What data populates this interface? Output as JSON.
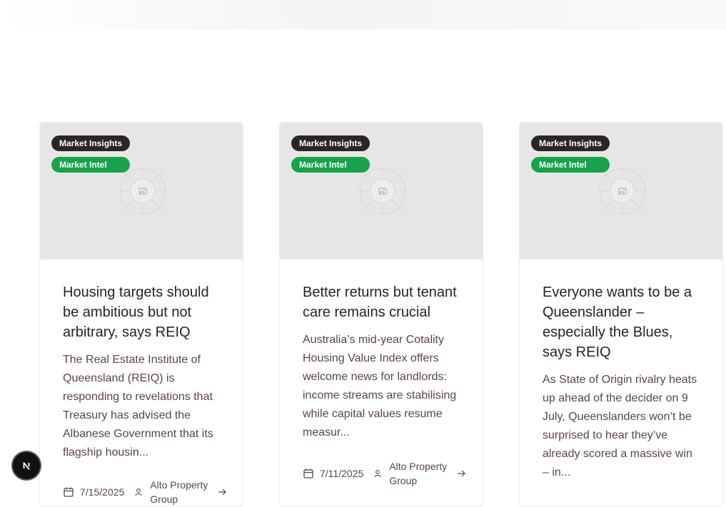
{
  "cards": [
    {
      "badge_category": "Market Insights",
      "badge_section": "Market Intel",
      "title": "Housing targets should be ambitious but not arbitrary, says REIQ",
      "excerpt": "The Real Estate Institute of Queensland (REIQ) is responding to revelations that Treasury has advised the Albanese Government that its flagship housin...",
      "date": "7/15/2025",
      "author": "Alto Property Group"
    },
    {
      "badge_category": "Market Insights",
      "badge_section": "Market Intel",
      "title": "Better returns but tenant care remains crucial",
      "excerpt": "Australia’s mid-year Cotality Housing Value Index offers welcome news for landlords: income streams are stabilising while capital values resume measur...",
      "date": "7/11/2025",
      "author": "Alto Property Group"
    },
    {
      "badge_category": "Market Insights",
      "badge_section": "Market Intel",
      "title": "Everyone wants to be a Queenslander – especially the Blues, says REIQ",
      "excerpt": "As State of Origin rivalry heats up ahead of the decider on 9 July, Queenslanders won’t be surprised to hear they’ve already scored a massive win – in...",
      "date": "",
      "author": ""
    }
  ],
  "nextjs_badge": {
    "letter": "N"
  },
  "colors": {
    "badge_dark": "#2c2523",
    "badge_green": "#16a34a",
    "image_placeholder": "#e6e6e6",
    "title_text": "#2a2220",
    "body_text": "#5a4640"
  }
}
